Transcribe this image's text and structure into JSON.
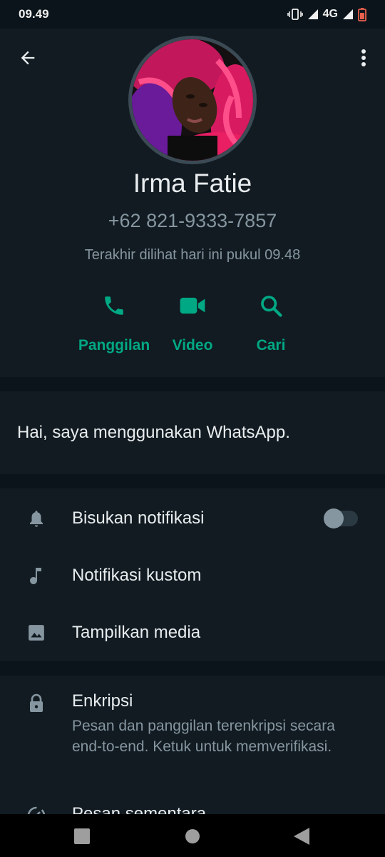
{
  "status_bar": {
    "time": "09.49",
    "network": "4G",
    "icons": [
      "vibrate-icon",
      "signal-icon",
      "signal-icon",
      "battery-icon"
    ]
  },
  "header": {
    "back_icon": "arrow-left-icon",
    "menu_icon": "more-vertical-icon"
  },
  "profile": {
    "name": "Irma Fatie",
    "phone": "+62 821-9333-7857",
    "last_seen": "Terakhir dilihat hari ini pukul 09.48"
  },
  "actions": [
    {
      "label": "Panggilan",
      "icon": "phone-icon"
    },
    {
      "label": "Video",
      "icon": "video-icon"
    },
    {
      "label": "Cari",
      "icon": "search-icon"
    }
  ],
  "about": {
    "text": "Hai, saya menggunakan WhatsApp."
  },
  "settings": [
    {
      "label": "Bisukan notifikasi",
      "icon": "bell-icon",
      "toggle": false
    },
    {
      "label": "Notifikasi kustom",
      "icon": "music-note-icon"
    },
    {
      "label": "Tampilkan media",
      "icon": "image-icon"
    }
  ],
  "encryption": {
    "title": "Enkripsi",
    "description": "Pesan dan panggilan terenkripsi secara end-to-end. Ketuk untuk memverifikasi.",
    "icon": "lock-icon"
  },
  "disappearing": {
    "title": "Pesan sementara",
    "icon": "timer-icon"
  },
  "colors": {
    "accent": "#00a884",
    "background": "#0b141a",
    "panel": "#111b21",
    "secondary_text": "#8696a0"
  },
  "nav": [
    "square-icon",
    "circle-icon",
    "triangle-back-icon"
  ]
}
